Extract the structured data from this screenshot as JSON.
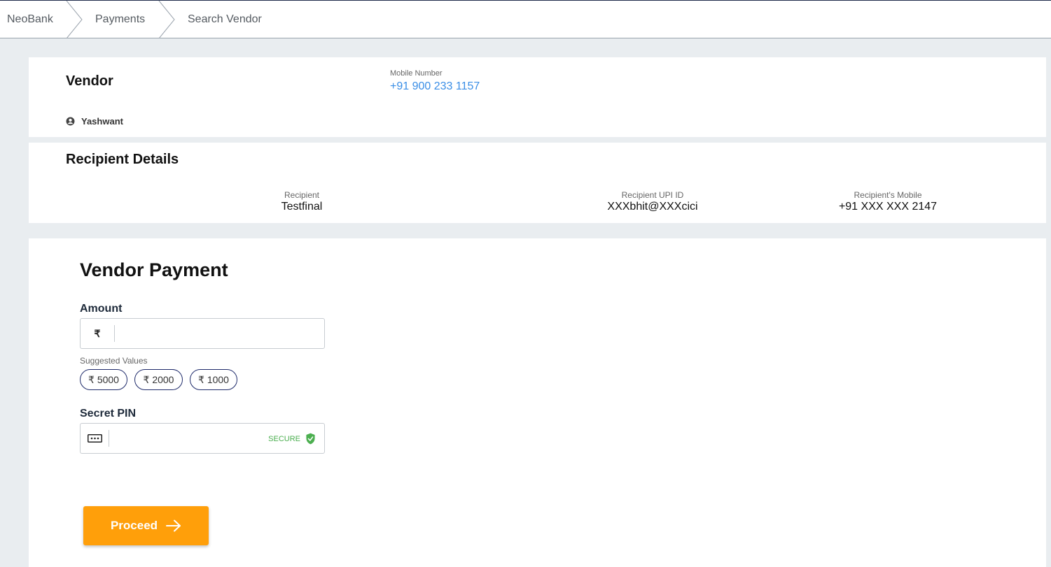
{
  "breadcrumb": {
    "items": [
      "NeoBank",
      "Payments",
      "Search Vendor"
    ]
  },
  "vendor": {
    "title": "Vendor",
    "mobile_label": "Mobile Number",
    "mobile_value": "+91 900 233 1157",
    "user_name": "Yashwant",
    "user_icon": "account-circle-icon"
  },
  "recipient": {
    "title": "Recipient Details",
    "fields": [
      {
        "label": "Recipient",
        "value": "Testfinal"
      },
      {
        "label": "Recipient UPI ID",
        "value": "XXXbhit@XXXcici"
      },
      {
        "label": "Recipient's Mobile",
        "value": "+91 XXX XXX 2147"
      }
    ]
  },
  "payment": {
    "title": "Vendor Payment",
    "amount_label": "Amount",
    "currency_symbol": "₹",
    "amount_value": "",
    "suggested_label": "Suggested Values",
    "suggestions": [
      "₹ 5000",
      "₹ 2000",
      "₹ 1000"
    ],
    "pin_label": "Secret PIN",
    "pin_icon": "password-dots-icon",
    "pin_value": "",
    "secure_text": "SECURE",
    "secure_icon": "shield-check-icon",
    "proceed_label": "Proceed",
    "proceed_icon": "arrow-right-icon"
  },
  "colors": {
    "accent": "#ff9f0a",
    "link": "#3a8ee6",
    "secure": "#4caf50",
    "chip_border": "#1e2a6a",
    "background": "#e9edf0"
  }
}
